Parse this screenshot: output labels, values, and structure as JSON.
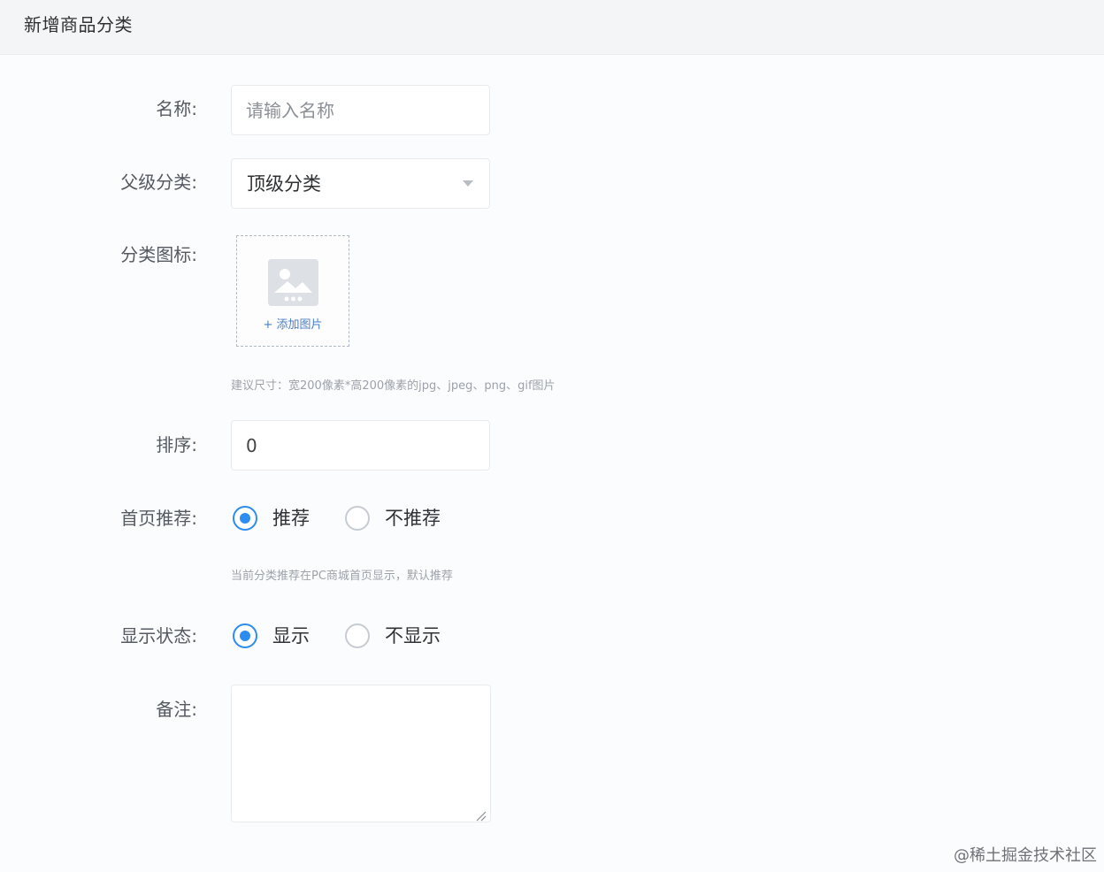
{
  "header": {
    "title": "新增商品分类"
  },
  "form": {
    "name": {
      "label": "名称:",
      "placeholder": "请输入名称"
    },
    "parent_category": {
      "label": "父级分类:",
      "selected": "顶级分类"
    },
    "category_icon": {
      "label": "分类图标:",
      "upload_label": "+ 添加图片",
      "hint": "建议尺寸：宽200像素*高200像素的jpg、jpeg、png、gif图片"
    },
    "sort": {
      "label": "排序:",
      "value": "0"
    },
    "homepage_recommend": {
      "label": "首页推荐:",
      "options": [
        {
          "label": "推荐",
          "checked": true
        },
        {
          "label": "不推荐",
          "checked": false
        }
      ],
      "hint": "当前分类推荐在PC商城首页显示，默认推荐"
    },
    "display_status": {
      "label": "显示状态:",
      "options": [
        {
          "label": "显示",
          "checked": true
        },
        {
          "label": "不显示",
          "checked": false
        }
      ]
    },
    "remark": {
      "label": "备注:"
    }
  },
  "watermark": "@稀土掘金技术社区",
  "colors": {
    "accent": "#2d8cf0",
    "link": "#4c7ec4",
    "border": "#e8eaee"
  }
}
